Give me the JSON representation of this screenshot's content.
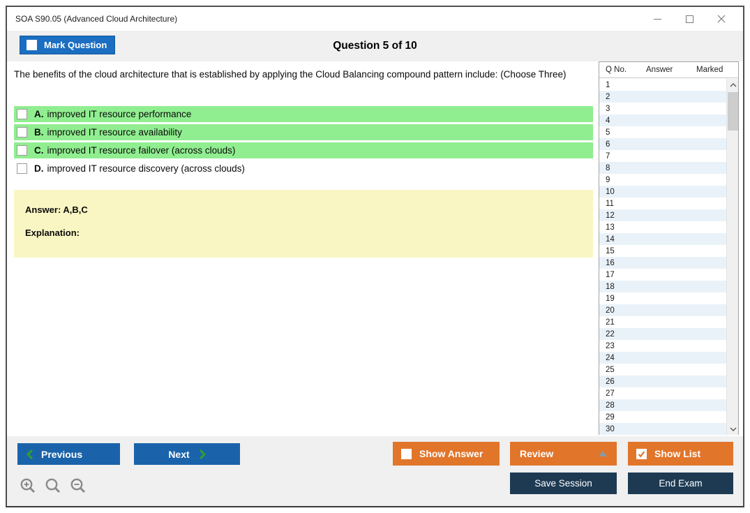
{
  "window": {
    "title": "SOA S90.05 (Advanced Cloud Architecture)"
  },
  "header": {
    "mark_question": "Mark Question",
    "question_counter": "Question 5 of 10",
    "mark_question_checked": false
  },
  "question": {
    "text": "The benefits of the cloud architecture that is established by applying the Cloud Balancing compound pattern include: (Choose Three)",
    "options": [
      {
        "letter": "A.",
        "text": "improved IT resource performance",
        "highlighted": true,
        "checked": false
      },
      {
        "letter": "B.",
        "text": "improved IT resource availability",
        "highlighted": true,
        "checked": false
      },
      {
        "letter": "C.",
        "text": "improved IT resource failover (across clouds)",
        "highlighted": true,
        "checked": false
      },
      {
        "letter": "D.",
        "text": "improved IT resource discovery (across clouds)",
        "highlighted": false,
        "checked": false
      }
    ]
  },
  "answer_panel": {
    "answer": "Answer: A,B,C",
    "explanation": "Explanation:"
  },
  "question_list": {
    "columns": [
      "Q No.",
      "Answer",
      "Marked"
    ],
    "rows": [
      {
        "q_no": "1",
        "answer": "",
        "marked": ""
      },
      {
        "q_no": "2",
        "answer": "",
        "marked": ""
      },
      {
        "q_no": "3",
        "answer": "",
        "marked": ""
      },
      {
        "q_no": "4",
        "answer": "",
        "marked": ""
      },
      {
        "q_no": "5",
        "answer": "",
        "marked": ""
      },
      {
        "q_no": "6",
        "answer": "",
        "marked": ""
      },
      {
        "q_no": "7",
        "answer": "",
        "marked": ""
      },
      {
        "q_no": "8",
        "answer": "",
        "marked": ""
      },
      {
        "q_no": "9",
        "answer": "",
        "marked": ""
      },
      {
        "q_no": "10",
        "answer": "",
        "marked": ""
      },
      {
        "q_no": "11",
        "answer": "",
        "marked": ""
      },
      {
        "q_no": "12",
        "answer": "",
        "marked": ""
      },
      {
        "q_no": "13",
        "answer": "",
        "marked": ""
      },
      {
        "q_no": "14",
        "answer": "",
        "marked": ""
      },
      {
        "q_no": "15",
        "answer": "",
        "marked": ""
      },
      {
        "q_no": "16",
        "answer": "",
        "marked": ""
      },
      {
        "q_no": "17",
        "answer": "",
        "marked": ""
      },
      {
        "q_no": "18",
        "answer": "",
        "marked": ""
      },
      {
        "q_no": "19",
        "answer": "",
        "marked": ""
      },
      {
        "q_no": "20",
        "answer": "",
        "marked": ""
      },
      {
        "q_no": "21",
        "answer": "",
        "marked": ""
      },
      {
        "q_no": "22",
        "answer": "",
        "marked": ""
      },
      {
        "q_no": "23",
        "answer": "",
        "marked": ""
      },
      {
        "q_no": "24",
        "answer": "",
        "marked": ""
      },
      {
        "q_no": "25",
        "answer": "",
        "marked": ""
      },
      {
        "q_no": "26",
        "answer": "",
        "marked": ""
      },
      {
        "q_no": "27",
        "answer": "",
        "marked": ""
      },
      {
        "q_no": "28",
        "answer": "",
        "marked": ""
      },
      {
        "q_no": "29",
        "answer": "",
        "marked": ""
      },
      {
        "q_no": "30",
        "answer": "",
        "marked": ""
      }
    ]
  },
  "footer": {
    "previous": "Previous",
    "next": "Next",
    "show_answer": "Show Answer",
    "show_answer_checked": false,
    "review": "Review",
    "show_list": "Show List",
    "show_list_checked": true,
    "save_session": "Save Session",
    "end_exam": "End Exam"
  },
  "colors": {
    "accent_blue": "#1B6EC1",
    "nav_blue": "#1A63AB",
    "orange": "#E1752A",
    "navy": "#1D3A52",
    "option_green": "#90EE90",
    "answer_yellow": "#FAF6C3",
    "row_alt_blue": "#EAF2F9",
    "chrome_gray": "#F0F0F0",
    "chevron_green": "#2EA02E"
  }
}
